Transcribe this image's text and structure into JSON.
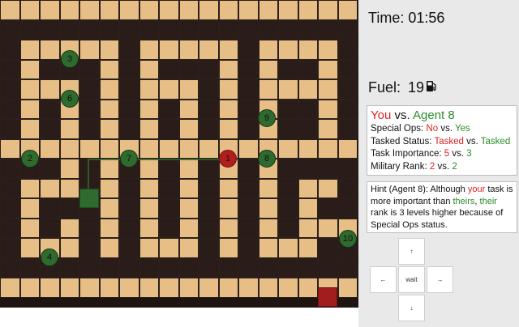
{
  "timer": {
    "label": "Time:",
    "value": "01:56"
  },
  "fuel": {
    "label": "Fuel:",
    "value": "19",
    "icon": "fuel-pump-icon"
  },
  "comparison": {
    "you": "You",
    "vs": "vs.",
    "opponent": "Agent 8",
    "rows": [
      {
        "label": "Special Ops:",
        "left": "No",
        "right": "Yes"
      },
      {
        "label": "Tasked Status:",
        "left": "Tasked",
        "right": "Tasked"
      },
      {
        "label": "Task Importance:",
        "left": "5",
        "right": "3"
      },
      {
        "label": "Military Rank:",
        "left": "2",
        "right": "2"
      }
    ]
  },
  "hint": {
    "prefix": "Hint (Agent 8): Although ",
    "your": "your",
    "mid": " task is more important than ",
    "theirs": "theirs",
    "comma": ", ",
    "their": "their",
    "suffix": " rank is 3 levels higher because of Special Ops status."
  },
  "controls": {
    "up": "↑",
    "left": "←",
    "wait": "wait",
    "right": "→",
    "down": "↓"
  },
  "agents": [
    {
      "label": "3"
    },
    {
      "label": "6"
    },
    {
      "label": "9"
    },
    {
      "label": "2"
    },
    {
      "label": "7"
    },
    {
      "label": "1"
    },
    {
      "label": "8"
    },
    {
      "label": "10"
    },
    {
      "label": "4"
    }
  ],
  "colors": {
    "open": "#e7bf86",
    "wall": "#2a1c19",
    "agent": "#2f6b2f",
    "self": "#b01e1e",
    "path": "#2f6b2f"
  }
}
